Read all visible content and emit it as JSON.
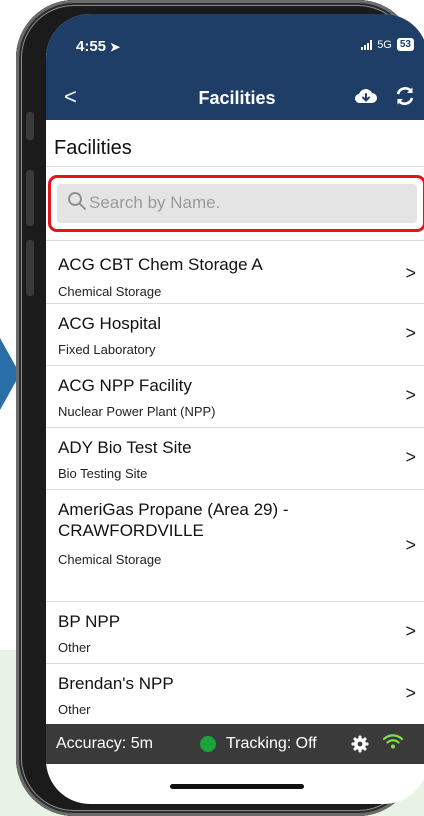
{
  "status_bar": {
    "time": "4:55",
    "network": "5G",
    "battery": "53"
  },
  "nav": {
    "back": "<",
    "title": "Facilities"
  },
  "page": {
    "title": "Facilities"
  },
  "search": {
    "placeholder": "Search by Name."
  },
  "facilities": [
    {
      "name": "ACG CBT Chem Storage A",
      "type": "Chemical Storage"
    },
    {
      "name": "ACG Hospital",
      "type": "Fixed Laboratory"
    },
    {
      "name": "ACG NPP Facility",
      "type": "Nuclear Power Plant (NPP)"
    },
    {
      "name": "ADY Bio Test Site",
      "type": "Bio Testing Site"
    },
    {
      "name": "AmeriGas Propane (Area 29) -",
      "name_line2": "CRAWFORDVILLE",
      "type": "Chemical Storage"
    },
    {
      "name": "BP NPP",
      "type": "Other"
    },
    {
      "name": "Brendan's NPP",
      "type": "Other"
    }
  ],
  "chevron": ">",
  "footer": {
    "accuracy": "Accuracy:  5m",
    "tracking": "Tracking:  Off"
  },
  "colors": {
    "nav_bg": "#1e3e68",
    "highlight": "#e4141b",
    "accuracy_dot": "#1ba43a",
    "wifi": "#7ee04a"
  }
}
